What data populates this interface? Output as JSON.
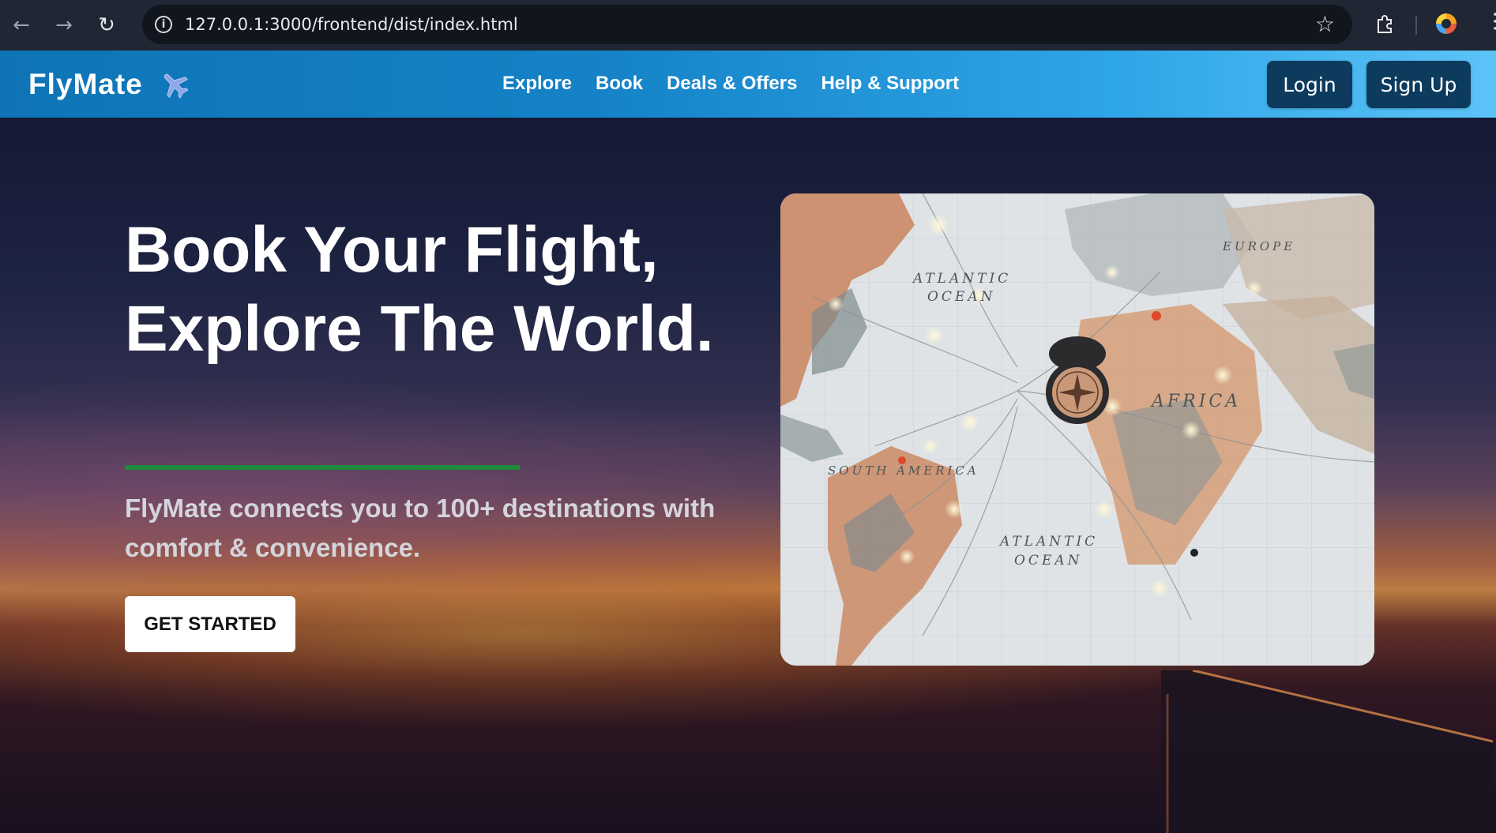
{
  "browser": {
    "url": "127.0.0.1:3000/frontend/dist/index.html",
    "icons": [
      "back-arrow-icon",
      "forward-arrow-icon",
      "reload-icon",
      "site-info-icon",
      "bookmark-star-icon",
      "extensions-icon",
      "profile-icon",
      "menu-icon"
    ]
  },
  "header": {
    "logo_text": "FlyMate",
    "nav": [
      "Explore",
      "Book",
      "Deals & Offers",
      "Help & Support"
    ],
    "login_label": "Login",
    "signup_label": "Sign Up",
    "colors": {
      "header_start": "#0e74b5",
      "header_end": "#5cc3f7",
      "auth_button": "#0d3b5e"
    }
  },
  "hero": {
    "title": "Book Your Flight, Explore The World.",
    "subtitle": "FlyMate connects you to 100+ destinations with comfort & convenience.",
    "cta_label": "GET STARTED",
    "underline_color": "#1f8a3b",
    "map_labels": {
      "atlantic_north": "ATLANTIC",
      "ocean_north": "OCEAN",
      "atlantic_south": "ATLANTIC",
      "ocean_south": "OCEAN",
      "africa": "AFRICA",
      "south_america": "SOUTH AMERICA",
      "europe": "EUROPE"
    }
  }
}
